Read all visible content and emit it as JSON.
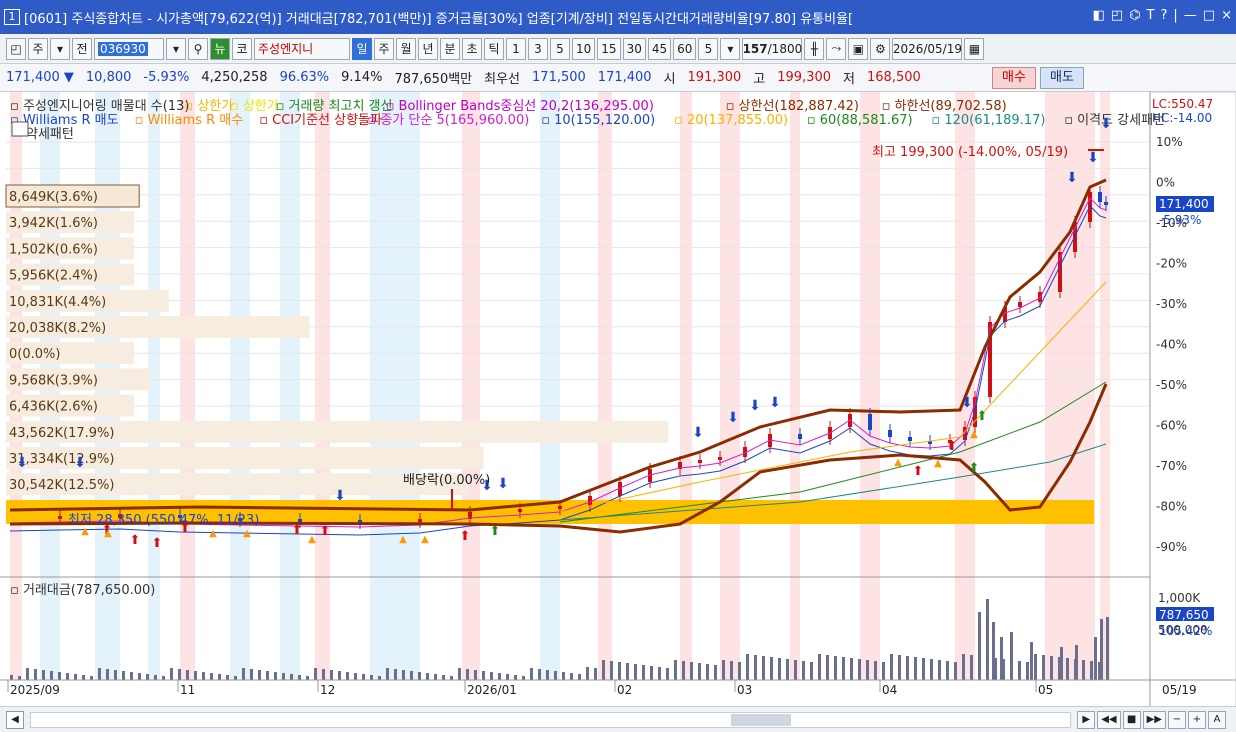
{
  "window": {
    "title": "[0601] 주식종합차트 - 시가총액[79,622(억)] 거래대금[782,701(백만)] 증거금률[30%] 업종[기계/장비] 전일동시간대거래량비율[97.80] 유통비율[",
    "window_number": "1",
    "controls": [
      "◧",
      "◰",
      "⌬",
      "T",
      "?",
      "|",
      "—",
      "□",
      "×"
    ]
  },
  "toolbar": {
    "period_selector": "주",
    "all_label": "전",
    "stock_code": "036930",
    "stock_name": "주성엔지니",
    "green_button": "뉴",
    "kor_button": "코",
    "periods": [
      "일",
      "주",
      "월",
      "년",
      "분",
      "초",
      "틱"
    ],
    "active_period": "일",
    "intervals": [
      "1",
      "3",
      "5",
      "10",
      "15",
      "30",
      "45",
      "60"
    ],
    "interval_value": "5",
    "count": "157",
    "count_total": "/1800",
    "date": "2026/05/19"
  },
  "quote": {
    "price": "171,400 ▼",
    "change": "10,800",
    "change_pct": "-5.93%",
    "volume": "4,250,258",
    "vol_ratio": "96.63%",
    "turnover": "9.14%",
    "amount": "787,650백만",
    "best_label": "최우선",
    "best_ask": "171,500",
    "best_bid": "171,400",
    "open_label": "시",
    "open": "191,300",
    "high_label": "고",
    "high": "199,300",
    "low_label": "저",
    "low": "168,500",
    "buy_label": "매수",
    "sell_label": "매도"
  },
  "legend": {
    "line1": [
      {
        "text": "주성엔지니어링 매물대 수(13)",
        "color": "#333333"
      },
      {
        "text": "상한가",
        "color": "#ffb000"
      },
      {
        "text": "상한가",
        "color": "#e6e600"
      },
      {
        "text": "거래량 최고치 갱신",
        "color": "#1a8a1a"
      },
      {
        "text": "Bollinger Bands중심선 20,2(136,295.00)",
        "color": "#c000c0"
      },
      {
        "text": "상한선(182,887.42)",
        "color": "#8b2b00"
      },
      {
        "text": "하한선(89,702.58)",
        "color": "#8b2b00"
      }
    ],
    "line2": [
      {
        "text": "Williams R 매도",
        "color": "#1a45c4"
      },
      {
        "text": "Williams R 매수",
        "color": "#ff8800"
      },
      {
        "text": "CCI기준선 상향돌파",
        "color": "#d01010"
      },
      {
        "text": "종가 단순 5(165,960.00)",
        "color": "#d020d0"
      },
      {
        "text": "10(155,120.00)",
        "color": "#1a45c4"
      },
      {
        "text": "20(137,855.00)",
        "color": "#ffb000"
      },
      {
        "text": "60(88,581.67)",
        "color": "#1a8a1a"
      },
      {
        "text": "120(61,189.17)",
        "color": "#1a8a8a"
      },
      {
        "text": "이격도 강세패턴",
        "color": "#333333"
      }
    ],
    "line3": "약세패턴"
  },
  "volume_profile": [
    "8,649K(3.6%)",
    "3,942K(1.6%)",
    "1,502K(0.6%)",
    "5,956K(2.4%)",
    "10,831K(4.4%)",
    "20,038K(8.2%)",
    "0(0.0%)",
    "9,568K(3.9%)",
    "6,436K(2.6%)",
    "43,562K(17.9%)",
    "31,334K(12.9%)",
    "30,542K(12.5%)"
  ],
  "volume_profile_pct": [
    3.6,
    1.6,
    0.6,
    2.4,
    4.4,
    8.2,
    0.0,
    3.9,
    2.6,
    17.9,
    12.9,
    12.5
  ],
  "annotations": {
    "high": "최고 199,300 (-14.00%, 05/19)",
    "low": "최저 28,350 (550.47%, 11/23)",
    "dividend": "배당락(0.00%)",
    "lc": "LC:550.47",
    "hc": "HC:-14.00"
  },
  "price_axis": [
    "10%",
    "0%",
    "-10%",
    "-20%",
    "-30%",
    "-40%",
    "-50%",
    "-60%",
    "-70%",
    "-80%",
    "-90%"
  ],
  "price_tag": {
    "value": "171,400",
    "pct": "-5.93%"
  },
  "volume_panel": {
    "title": "거래대금(787,650.00)",
    "axis": [
      "1,000K",
      "500,000"
    ],
    "tag_value": "787,650",
    "tag_pct": "105.42%"
  },
  "time_axis": [
    "2025/09",
    "11",
    "12",
    "2026/01",
    "02",
    "03",
    "04",
    "05"
  ],
  "time_axis_right": "05/19",
  "colors": {
    "up": "#d01010",
    "down": "#1a45c4",
    "band": "#8b2b00",
    "zone": "#ffc000"
  }
}
